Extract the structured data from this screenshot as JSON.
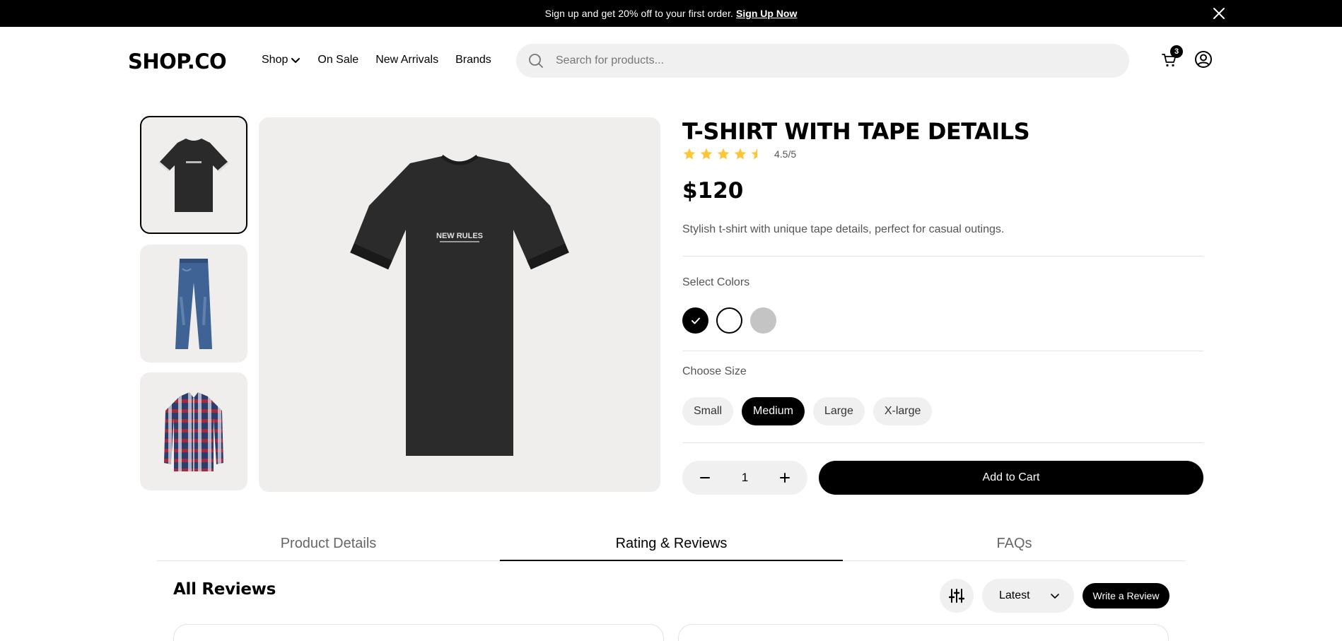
{
  "promo": {
    "text": "Sign up and get 20% off to your first order.",
    "link": "Sign Up Now",
    "close_icon": "close-icon"
  },
  "header": {
    "logo": "SHOP.CO",
    "nav": [
      {
        "label": "Shop",
        "has_dropdown": true
      },
      {
        "label": "On Sale"
      },
      {
        "label": "New Arrivals"
      },
      {
        "label": "Brands"
      }
    ],
    "search": {
      "placeholder": "Search for products...",
      "value": "",
      "icon": "search-icon"
    },
    "cart": {
      "icon": "cart-icon",
      "count": "3"
    },
    "profile": {
      "icon": "user-circle-icon"
    }
  },
  "gallery": {
    "thumbnails": [
      {
        "name": "black-tshirt",
        "active": true
      },
      {
        "name": "blue-jeans",
        "active": false
      },
      {
        "name": "plaid-shirt",
        "active": false
      }
    ],
    "main_image": {
      "graphic_text": "NEW RULES"
    }
  },
  "product": {
    "title": "T-SHIRT WITH TAPE DETAILS",
    "rating": 4.5,
    "rating_text": "4.5/5",
    "price": "$120",
    "description": "Stylish t-shirt with unique tape details, perfect for casual outings.",
    "colors_label": "Select Colors",
    "colors": [
      {
        "hex": "#000000",
        "selected": true
      },
      {
        "hex": "#ffffff",
        "selected": false
      },
      {
        "hex": "#c4c4c4",
        "selected": false
      }
    ],
    "size_label": "Choose Size",
    "sizes": [
      {
        "label": "Small",
        "active": false
      },
      {
        "label": "Medium",
        "active": true
      },
      {
        "label": "Large",
        "active": false
      },
      {
        "label": "X-large",
        "active": false
      }
    ],
    "quantity": "1",
    "add_to_cart": "Add to Cart"
  },
  "tabs": [
    {
      "label": "Product Details",
      "active": false
    },
    {
      "label": "Rating & Reviews",
      "active": true
    },
    {
      "label": "FAQs",
      "active": false
    }
  ],
  "reviews": {
    "title": "All Reviews",
    "filter_icon": "sliders-icon",
    "sort_value": "Latest",
    "write_label": "Write a Review"
  },
  "colors": {
    "accent": "#000000",
    "star": "#FFC633",
    "surface": "#F0F0F0",
    "image_bg": "#F0EEED"
  }
}
